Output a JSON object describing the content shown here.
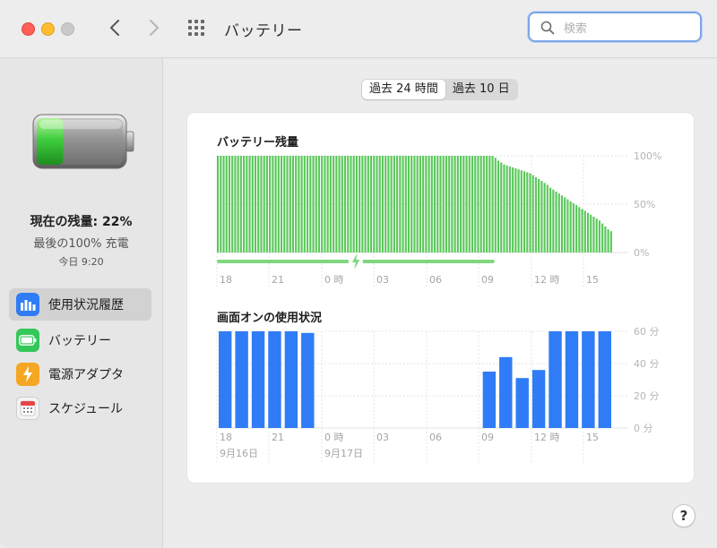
{
  "window": {
    "title": "バッテリー"
  },
  "search": {
    "placeholder": "検索",
    "value": ""
  },
  "sidebar": {
    "status_main": "現在の残量: 22%",
    "last_charge": "最後の100% 充電",
    "last_charge_time": "今日 9:20",
    "battery_level_pct": 22,
    "items": [
      {
        "label": "使用状況履歴",
        "icon": "bar-chart-icon",
        "color": "#2f7cf6",
        "active": true
      },
      {
        "label": "バッテリー",
        "icon": "battery-icon",
        "color": "#34c759",
        "active": false
      },
      {
        "label": "電源アダプタ",
        "icon": "bolt-icon",
        "color": "#f5a623",
        "active": false
      },
      {
        "label": "スケジュール",
        "icon": "calendar-icon",
        "color": "#e8e8e8",
        "active": false
      }
    ]
  },
  "segment": {
    "options": [
      "過去 24 時間",
      "過去 10 日"
    ],
    "selected": 0
  },
  "help_label": "?",
  "colors": {
    "battery_green": "#5ac85a",
    "screen_blue": "#2f7cf6",
    "charging_green": "#7fd87f"
  },
  "chart_data": [
    {
      "type": "bar",
      "title": "バッテリー残量",
      "ylim": [
        0,
        100
      ],
      "y_ticks": [
        "100%",
        "50%",
        "0%"
      ],
      "x_ticks": [
        "18",
        "21",
        "0 時",
        "03",
        "06",
        "09",
        "12 時",
        "15"
      ],
      "values": [
        100,
        100,
        100,
        100,
        100,
        100,
        100,
        100,
        100,
        100,
        100,
        100,
        100,
        100,
        100,
        100,
        100,
        100,
        100,
        100,
        100,
        100,
        100,
        100,
        100,
        100,
        100,
        100,
        100,
        100,
        100,
        100,
        100,
        100,
        100,
        100,
        100,
        100,
        100,
        100,
        100,
        100,
        100,
        100,
        100,
        100,
        100,
        100,
        100,
        100,
        100,
        100,
        100,
        100,
        100,
        100,
        100,
        100,
        100,
        100,
        100,
        100,
        100,
        100,
        100,
        100,
        100,
        100,
        100,
        100,
        100,
        100,
        100,
        100,
        100,
        100,
        100,
        100,
        100,
        100,
        100,
        100,
        100,
        100,
        100,
        100,
        100,
        100,
        100,
        100,
        100,
        100,
        100,
        100,
        100,
        100,
        98,
        95,
        93,
        91,
        90,
        89,
        88,
        87,
        86,
        85,
        84,
        83,
        82,
        80,
        78,
        76,
        74,
        72,
        70,
        67,
        65,
        63,
        61,
        59,
        57,
        55,
        53,
        51,
        49,
        47,
        45,
        43,
        41,
        39,
        37,
        35,
        33,
        30,
        27,
        24,
        22
      ],
      "charging_until_index": 96
    },
    {
      "type": "bar",
      "title": "画面オンの使用状況",
      "ylim": [
        0,
        60
      ],
      "y_ticks": [
        "60 分",
        "40 分",
        "20 分",
        "0 分"
      ],
      "x_ticks": [
        "18",
        "21",
        "0 時",
        "03",
        "06",
        "09",
        "12 時",
        "15"
      ],
      "date_labels": [
        "9月16日",
        "9月17日"
      ],
      "values": [
        60,
        60,
        60,
        60,
        60,
        59,
        0,
        0,
        0,
        0,
        0,
        0,
        0,
        0,
        0,
        0,
        35,
        44,
        31,
        36,
        60,
        60,
        60,
        60
      ]
    }
  ]
}
